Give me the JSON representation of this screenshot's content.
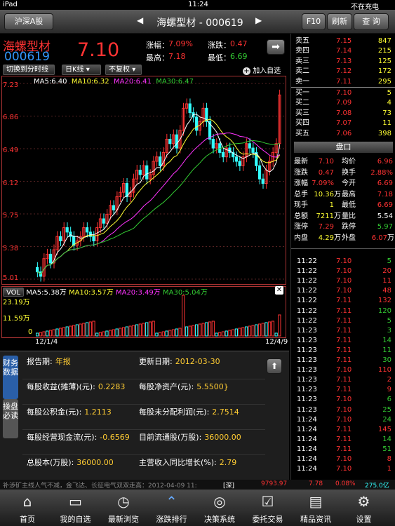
{
  "status": {
    "device": "iPad",
    "time": "11:24",
    "battery": "不在充电"
  },
  "nav": {
    "market_label": "沪深A股",
    "title": "海螺型材 - 000619",
    "f10": "F10",
    "refresh": "刷新",
    "query": "查 询"
  },
  "quote": {
    "name": "海螺型材",
    "code": "000619",
    "price": "7.10",
    "change_pct_label": "涨幅：",
    "change_pct": "7.09%",
    "change_label": "涨跌：",
    "change": "0.47",
    "high_label": "最高：",
    "high": "7.18",
    "low_label": "最低：",
    "low": "6.69"
  },
  "toolbar": {
    "switch_timeshare": "切换到分时线",
    "period": "日K线",
    "adjust": "不复权",
    "add_fav": "加入自选"
  },
  "kline": {
    "ma_labels": [
      "MA5:6.40",
      "MA10:6.32",
      "MA20:6.41",
      "MA30:6.47"
    ],
    "y_ticks": [
      "7.23",
      "6.86",
      "6.49",
      "6.12",
      "5.75",
      "5.38",
      "5.01"
    ],
    "vol_labels": [
      "VOL",
      "MA5:5.38万",
      "MA10:3.57万",
      "MA20:3.49万",
      "MA30:5.04万"
    ],
    "vol_ticks": [
      "23.19万",
      "11.59万",
      "0"
    ],
    "date_start": "12/1/4",
    "date_end": "12/4/9"
  },
  "orderbook": [
    {
      "label": "卖五",
      "price": "7.15",
      "vol": "847"
    },
    {
      "label": "卖四",
      "price": "7.14",
      "vol": "215"
    },
    {
      "label": "卖三",
      "price": "7.13",
      "vol": "125"
    },
    {
      "label": "卖二",
      "price": "7.12",
      "vol": "172"
    },
    {
      "label": "卖一",
      "price": "7.11",
      "vol": "295"
    },
    {
      "label": "买一",
      "price": "7.10",
      "vol": "5"
    },
    {
      "label": "买二",
      "price": "7.09",
      "vol": "4"
    },
    {
      "label": "买三",
      "price": "7.08",
      "vol": "73"
    },
    {
      "label": "买四",
      "price": "7.07",
      "vol": "11"
    },
    {
      "label": "买五",
      "price": "7.06",
      "vol": "398"
    }
  ],
  "pankou": {
    "title": "盘口",
    "rows": [
      {
        "a": "最新",
        "av": "7.10",
        "b": "均价",
        "bv": "6.96"
      },
      {
        "a": "涨跌",
        "av": "0.47",
        "b": "换手",
        "bv": "2.88%"
      },
      {
        "a": "涨幅",
        "av": "7.09%",
        "b": "今开",
        "bv": "6.69"
      },
      {
        "a": "总手",
        "av": "10.36",
        "au": "万",
        "b": "最高",
        "bv": "7.18"
      },
      {
        "a": "现手",
        "av": "1",
        "b": "最低",
        "bv": "6.69"
      },
      {
        "a": "总额",
        "av": "7211",
        "au": "万",
        "b": "量比",
        "bv": "5.54"
      },
      {
        "a": "涨停",
        "av": "7.29",
        "b": "跌停",
        "bv": "5.97"
      },
      {
        "a": "内盘",
        "av": "4.29",
        "au": "万",
        "b": "外盘",
        "bv": "6.07",
        "bu": "万"
      }
    ]
  },
  "ticks": [
    {
      "t": "11:22",
      "p": "7.10",
      "v": "5"
    },
    {
      "t": "11:22",
      "p": "7.10",
      "v": "20"
    },
    {
      "t": "11:22",
      "p": "7.10",
      "v": "11"
    },
    {
      "t": "11:22",
      "p": "7.10",
      "v": "48"
    },
    {
      "t": "11:22",
      "p": "7.11",
      "v": "132"
    },
    {
      "t": "11:22",
      "p": "7.11",
      "v": "120"
    },
    {
      "t": "11:22",
      "p": "7.11",
      "v": "5"
    },
    {
      "t": "11:23",
      "p": "7.11",
      "v": "3"
    },
    {
      "t": "11:23",
      "p": "7.11",
      "v": "14"
    },
    {
      "t": "11:23",
      "p": "7.11",
      "v": "11"
    },
    {
      "t": "11:23",
      "p": "7.11",
      "v": "30"
    },
    {
      "t": "11:23",
      "p": "7.10",
      "v": "110"
    },
    {
      "t": "11:23",
      "p": "7.11",
      "v": "2"
    },
    {
      "t": "11:23",
      "p": "7.11",
      "v": "9"
    },
    {
      "t": "11:23",
      "p": "7.10",
      "v": "6"
    },
    {
      "t": "11:23",
      "p": "7.10",
      "v": "25"
    },
    {
      "t": "11:24",
      "p": "7.10",
      "v": "24"
    },
    {
      "t": "11:24",
      "p": "7.11",
      "v": "145"
    },
    {
      "t": "11:24",
      "p": "7.11",
      "v": "14"
    },
    {
      "t": "11:24",
      "p": "7.11",
      "v": "51"
    },
    {
      "t": "11:24",
      "p": "7.10",
      "v": "8"
    },
    {
      "t": "11:24",
      "p": "7.10",
      "v": "1"
    }
  ],
  "info": {
    "tab1": "财务数据",
    "tab2": "操盘必读",
    "cells": [
      {
        "label": "报告期:",
        "value": "年报"
      },
      {
        "label": "更新日期:",
        "value": "2012-03-30"
      },
      {
        "label": "每股收益(摊薄)(元):",
        "value": "0.2283"
      },
      {
        "label": "每股净资产(元):",
        "value": "5.5500}"
      },
      {
        "label": "每股公积金(元):",
        "value": "1.2113"
      },
      {
        "label": "每股未分配利润(元):",
        "value": "2.7514"
      },
      {
        "label": "每股经营现金流(元):",
        "value": "-0.6569"
      },
      {
        "label": "目前流通股(万股):",
        "value": "36000.00"
      },
      {
        "label": "总股本(万股):",
        "value": "36000.00"
      },
      {
        "label": "主营收入同比增长(%):",
        "value": "2.79"
      }
    ]
  },
  "ticker": {
    "text": "补涉矿主线人气不减，金飞达、长征电气双双走高：2012-04-09 11:",
    "tag": "[深]",
    "index": "9793.97",
    "chg": "7.78",
    "pct": "0.08%",
    "amount": "275.0亿"
  },
  "tabs": [
    {
      "label": "首页",
      "icon": "home-icon"
    },
    {
      "label": "我的自选",
      "icon": "folder-icon"
    },
    {
      "label": "最新浏览",
      "icon": "clock-icon"
    },
    {
      "label": "涨跌排行",
      "icon": "chevrons-up-icon"
    },
    {
      "label": "决策系统",
      "icon": "target-icon"
    },
    {
      "label": "委托交易",
      "icon": "checklist-icon"
    },
    {
      "label": "精品资讯",
      "icon": "news-icon"
    },
    {
      "label": "设置",
      "icon": "gear-icon"
    }
  ]
}
